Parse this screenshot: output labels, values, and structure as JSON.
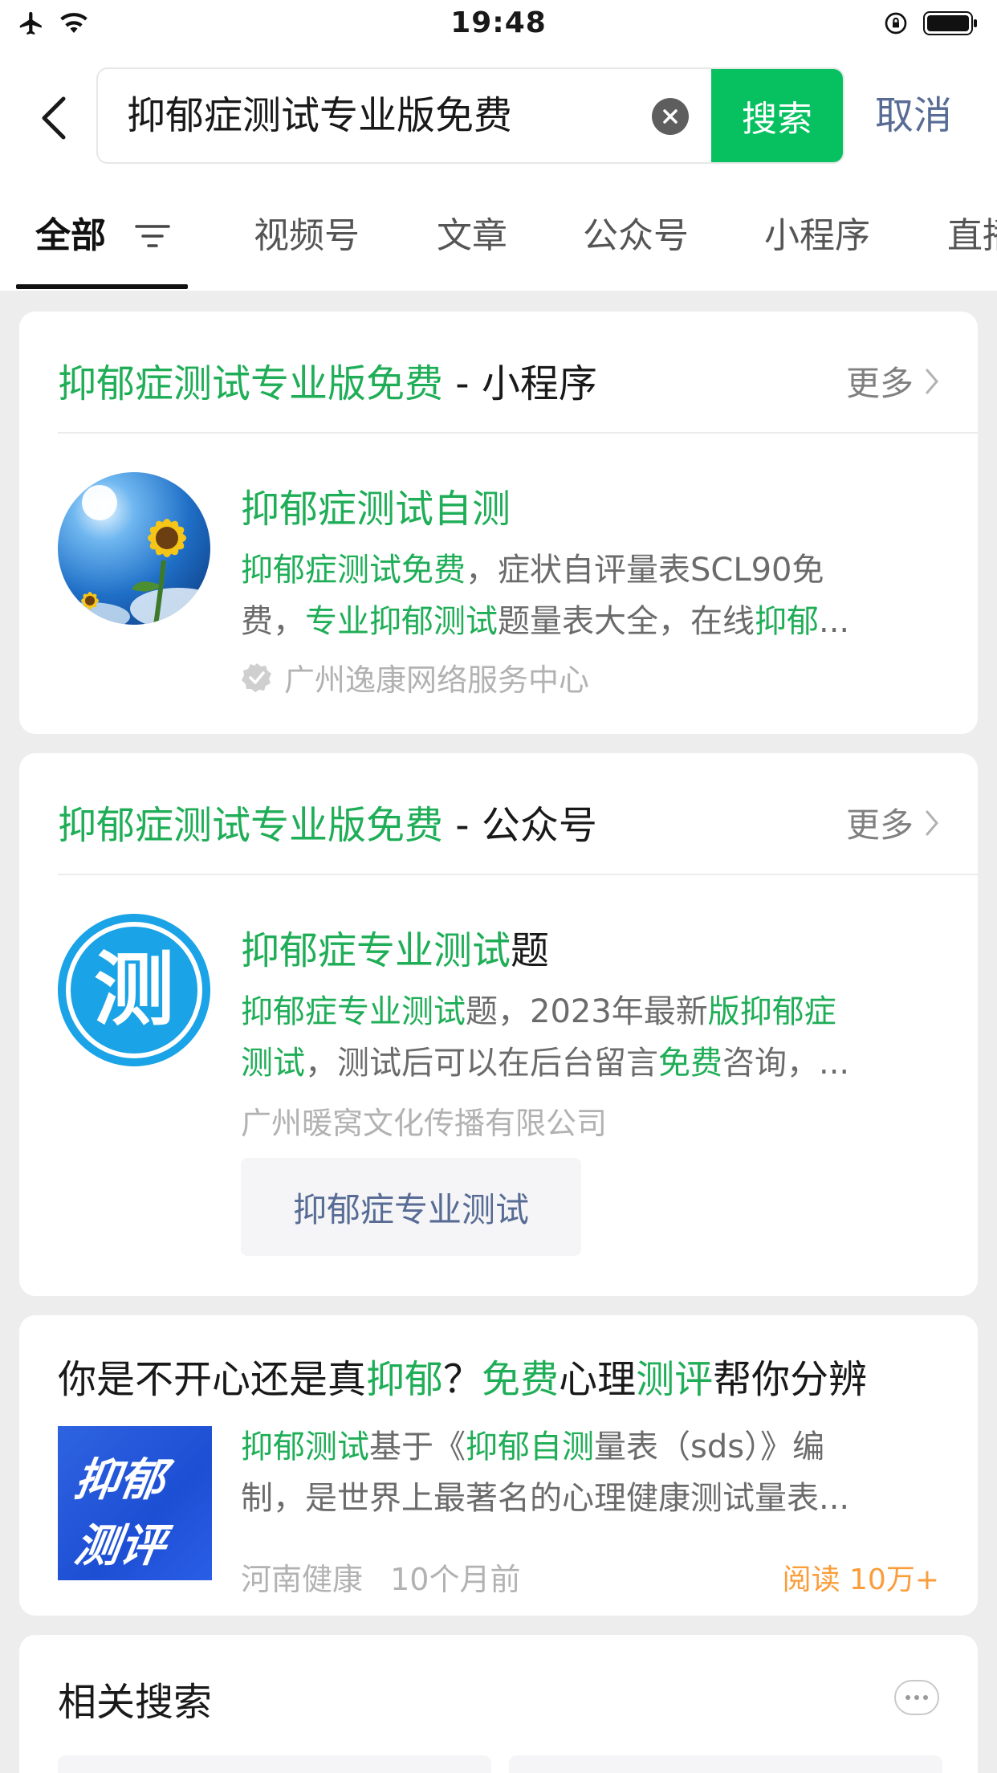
{
  "status_bar": {
    "time": "19:48"
  },
  "search": {
    "query": "抑郁症测试专业版免费",
    "search_label": "搜索",
    "cancel_label": "取消"
  },
  "tabs": [
    "全部",
    "视频号",
    "文章",
    "公众号",
    "小程序",
    "直播"
  ],
  "miniprogram_section": {
    "title_keyword": "抑郁症测试专业版免费",
    "title_suffix": " - 小程序",
    "more_label": "更多",
    "item": {
      "title": "抑郁症测试自测",
      "desc_line1": [
        {
          "text": "抑郁症测试免费",
          "hl": true
        },
        {
          "text": "，症状自评量表SCL90免",
          "hl": false
        }
      ],
      "desc_line2": [
        {
          "text": "费，",
          "hl": false
        },
        {
          "text": "专业抑郁测试",
          "hl": true
        },
        {
          "text": "题量表大全，在线",
          "hl": false
        },
        {
          "text": "抑郁",
          "hl": true
        },
        {
          "text": "...",
          "hl": false
        }
      ],
      "developer": "广州逸康网络服务中心"
    }
  },
  "official_account_section": {
    "title_keyword": "抑郁症测试专业版免费",
    "title_suffix": " - 公众号",
    "more_label": "更多",
    "item": {
      "title": [
        {
          "text": "抑郁症专业测试",
          "hl": true
        },
        {
          "text": "题",
          "hl": false
        }
      ],
      "avatar_char": "测",
      "desc_line1": [
        {
          "text": "抑郁症专业测试",
          "hl": true
        },
        {
          "text": "题，2023年最新",
          "hl": false
        },
        {
          "text": "版抑郁症",
          "hl": true
        }
      ],
      "desc_line2": [
        {
          "text": "测试",
          "hl": true
        },
        {
          "text": "，测试后可以在后台留言",
          "hl": false
        },
        {
          "text": "免费",
          "hl": true
        },
        {
          "text": "咨询，...",
          "hl": false
        }
      ],
      "company": "广州暖窝文化传播有限公司",
      "menu_chip": "抑郁症专业测试"
    }
  },
  "article": {
    "title": [
      {
        "text": "你是不开心还是真",
        "hl": false
      },
      {
        "text": "抑郁",
        "hl": true
      },
      {
        "text": "？",
        "hl": false
      },
      {
        "text": "免费",
        "hl": true
      },
      {
        "text": "心理",
        "hl": false
      },
      {
        "text": "测评",
        "hl": true
      },
      {
        "text": "帮你分辨",
        "hl": false
      }
    ],
    "thumb_line1": "抑郁",
    "thumb_line2": "测评",
    "desc_line1": [
      {
        "text": "抑郁测试",
        "hl": true
      },
      {
        "text": "基于《",
        "hl": false
      },
      {
        "text": "抑郁自测",
        "hl": true
      },
      {
        "text": "量表（sds）》编",
        "hl": false
      }
    ],
    "desc_line2": [
      {
        "text": "制，是世界上最著名的心理健康测试量表...",
        "hl": false
      }
    ],
    "source": "河南健康",
    "time": "10个月前",
    "read_count": "阅读 10万+"
  },
  "related": {
    "title": "相关搜索"
  },
  "colors": {
    "accent_green": "#07c160",
    "highlight_green": "#1fae57",
    "link_blue": "#576b95",
    "orange": "#fa9d3b"
  }
}
